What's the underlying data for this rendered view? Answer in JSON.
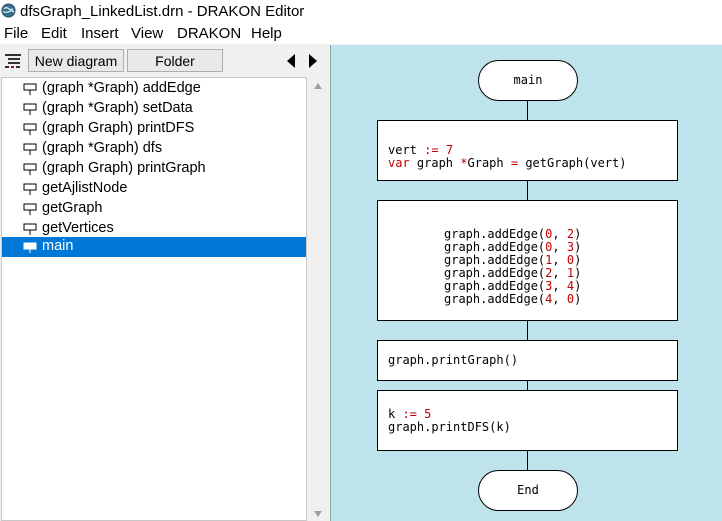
{
  "window": {
    "title": "dfsGraph_LinkedList.drn - DRAKON Editor"
  },
  "menu": {
    "items": [
      "File",
      "Edit",
      "Insert",
      "View",
      "DRAKON",
      "Help"
    ]
  },
  "toolbar": {
    "new_diagram": "New diagram",
    "folder": "Folder"
  },
  "tree": {
    "items": [
      {
        "label": "(graph  *Graph) addEdge",
        "selected": false
      },
      {
        "label": "(graph  *Graph) setData",
        "selected": false
      },
      {
        "label": "(graph  Graph) printDFS",
        "selected": false
      },
      {
        "label": "(graph *Graph) dfs",
        "selected": false
      },
      {
        "label": "(graph Graph) printGraph",
        "selected": false
      },
      {
        "label": "getAjlistNode",
        "selected": false
      },
      {
        "label": "getGraph",
        "selected": false
      },
      {
        "label": "getVertices",
        "selected": false
      },
      {
        "label": "main",
        "selected": true
      }
    ]
  },
  "diagram": {
    "start": "main",
    "end": "End",
    "action1": {
      "line1": [
        "vert ",
        ":=",
        " ",
        "7"
      ],
      "line2": [
        "var",
        " graph ",
        "*",
        "Graph ",
        "=",
        " getGraph(vert)"
      ]
    },
    "edges": [
      [
        "0",
        "2"
      ],
      [
        "0",
        "3"
      ],
      [
        "1",
        "0"
      ],
      [
        "2",
        "1"
      ],
      [
        "3",
        "4"
      ],
      [
        "4",
        "0"
      ]
    ],
    "edge_call": "graph.addEdge",
    "action3": "graph.printGraph()",
    "action4": {
      "line1": [
        "k ",
        ":=",
        " ",
        "5"
      ],
      "line2": "graph.printDFS(k)"
    }
  }
}
